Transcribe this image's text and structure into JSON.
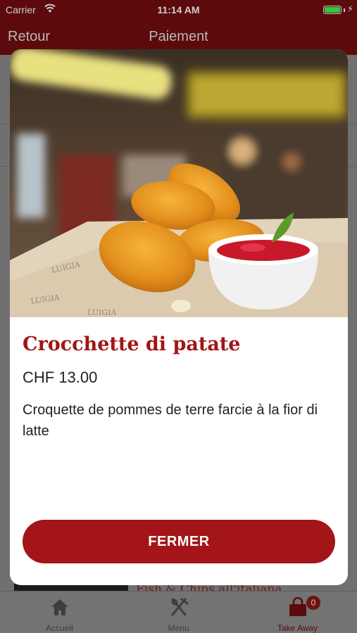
{
  "status_bar": {
    "carrier": "Carrier",
    "time": "11:14 AM",
    "battery_level": 1.0
  },
  "nav_bar": {
    "back_label": "Retour",
    "title": "Paiement"
  },
  "background": {
    "item_text": "Fish & Chips all'italiana"
  },
  "modal": {
    "image_icon": "croquettes-photo",
    "name": "Crocchette di patate",
    "price": "CHF 13.00",
    "description": "Croquette de pommes de terre farcie à la fior di latte",
    "close_label": "FERMER",
    "colors": {
      "accent": "#a31518",
      "text": "#222222"
    }
  },
  "tab_bar": {
    "tabs": [
      {
        "label": "Accueil",
        "icon": "home-icon"
      },
      {
        "label": "Menu",
        "icon": "fork-knife-icon"
      },
      {
        "label": "Take Away",
        "icon": "shopping-bag-icon",
        "badge": "0",
        "active": true
      }
    ]
  }
}
